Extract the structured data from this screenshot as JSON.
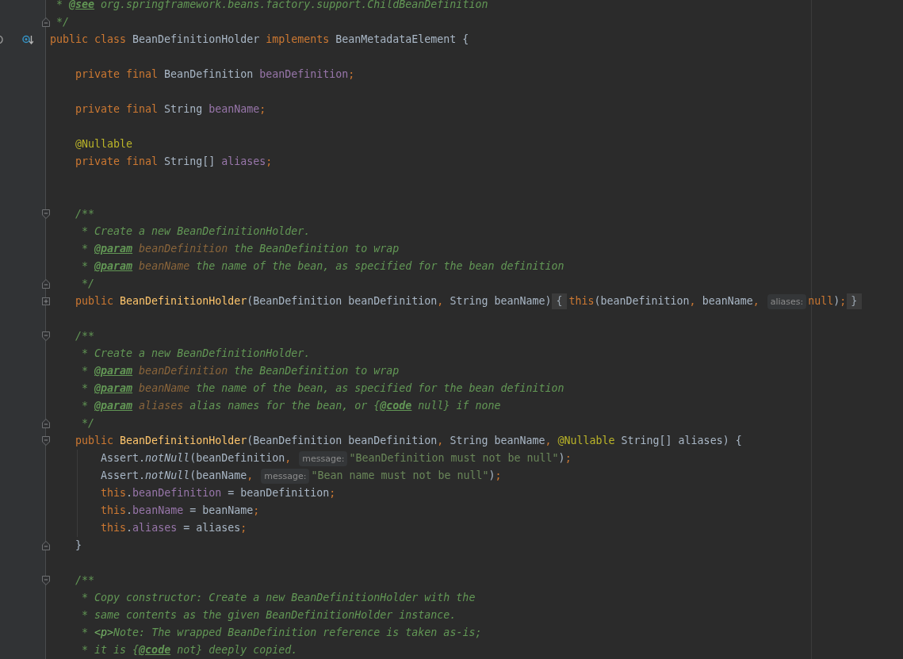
{
  "editor": {
    "lines": [
      {
        "kind": "code",
        "parts": [
          {
            "kind": "code",
            "tokens": [
              {
                "text": " * ",
                "kind": "doc"
              },
              {
                "text": "@see",
                "kind": "doc-tag"
              },
              {
                "text": " org.springframework.beans.factory.support.ChildBeanDefinition",
                "kind": "doc"
              }
            ]
          }
        ]
      },
      {
        "kind": "code",
        "fold": {
          "kind": "end"
        },
        "parts": [
          {
            "kind": "code",
            "tokens": [
              {
                "text": " */",
                "kind": "doc"
              }
            ]
          }
        ]
      },
      {
        "kind": "code",
        "gutter_icons": [
          {
            "kind": "arc"
          },
          {
            "kind": "implemented"
          }
        ],
        "parts": [
          {
            "kind": "code",
            "tokens": [
              {
                "text": "public class ",
                "kind": "keyword"
              },
              {
                "text": "BeanDefinitionHolder ",
                "kind": "plain"
              },
              {
                "text": "implements ",
                "kind": "keyword"
              },
              {
                "text": "BeanMetadataElement {",
                "kind": "plain"
              }
            ]
          }
        ]
      },
      {
        "kind": "blank"
      },
      {
        "kind": "code",
        "parts": [
          {
            "kind": "code",
            "tokens": [
              {
                "text": "    private final ",
                "kind": "keyword"
              },
              {
                "text": "BeanDefinition ",
                "kind": "plain"
              },
              {
                "text": "beanDefinition",
                "kind": "field"
              },
              {
                "text": ";",
                "kind": "keyword"
              }
            ]
          }
        ]
      },
      {
        "kind": "blank"
      },
      {
        "kind": "code",
        "parts": [
          {
            "kind": "code",
            "tokens": [
              {
                "text": "    private final ",
                "kind": "keyword"
              },
              {
                "text": "String ",
                "kind": "plain"
              },
              {
                "text": "beanName",
                "kind": "field"
              },
              {
                "text": ";",
                "kind": "keyword"
              }
            ]
          }
        ]
      },
      {
        "kind": "blank"
      },
      {
        "kind": "code",
        "parts": [
          {
            "kind": "code",
            "tokens": [
              {
                "text": "    @Nullable",
                "kind": "annotation"
              }
            ]
          }
        ]
      },
      {
        "kind": "code",
        "parts": [
          {
            "kind": "code",
            "tokens": [
              {
                "text": "    private final ",
                "kind": "keyword"
              },
              {
                "text": "String[] ",
                "kind": "plain"
              },
              {
                "text": "aliases",
                "kind": "field"
              },
              {
                "text": ";",
                "kind": "keyword"
              }
            ]
          }
        ]
      },
      {
        "kind": "blank"
      },
      {
        "kind": "blank"
      },
      {
        "kind": "code",
        "fold": {
          "kind": "start"
        },
        "parts": [
          {
            "kind": "code",
            "tokens": [
              {
                "text": "    /**",
                "kind": "doc"
              }
            ]
          }
        ]
      },
      {
        "kind": "code",
        "parts": [
          {
            "kind": "code",
            "tokens": [
              {
                "text": "     * Create a new BeanDefinitionHolder.",
                "kind": "doc"
              }
            ]
          }
        ]
      },
      {
        "kind": "code",
        "parts": [
          {
            "kind": "code",
            "tokens": [
              {
                "text": "     * ",
                "kind": "doc"
              },
              {
                "text": "@param",
                "kind": "doc-tag"
              },
              {
                "text": " beanDefinition",
                "kind": "doc-param"
              },
              {
                "text": " the BeanDefinition to wrap",
                "kind": "doc"
              }
            ]
          }
        ]
      },
      {
        "kind": "code",
        "parts": [
          {
            "kind": "code",
            "tokens": [
              {
                "text": "     * ",
                "kind": "doc"
              },
              {
                "text": "@param",
                "kind": "doc-tag"
              },
              {
                "text": " beanName",
                "kind": "doc-param"
              },
              {
                "text": " the name of the bean, as specified for the bean definition",
                "kind": "doc"
              }
            ]
          }
        ]
      },
      {
        "kind": "code",
        "fold": {
          "kind": "end"
        },
        "parts": [
          {
            "kind": "code",
            "tokens": [
              {
                "text": "     */",
                "kind": "doc"
              }
            ]
          }
        ]
      },
      {
        "kind": "code",
        "fold": {
          "kind": "collapsed"
        },
        "parts": [
          {
            "kind": "code",
            "tokens": [
              {
                "text": "    public ",
                "kind": "keyword"
              },
              {
                "text": "BeanDefinitionHolder",
                "kind": "method"
              },
              {
                "text": "(BeanDefinition beanDefinition",
                "kind": "plain"
              },
              {
                "text": ", ",
                "kind": "keyword"
              },
              {
                "text": "String beanName)",
                "kind": "plain"
              }
            ]
          },
          {
            "kind": "fold",
            "text": "{"
          },
          {
            "kind": "code",
            "tokens": [
              {
                "text": "this",
                "kind": "keyword"
              },
              {
                "text": "(beanDefinition",
                "kind": "plain"
              },
              {
                "text": ", ",
                "kind": "keyword"
              },
              {
                "text": "beanName",
                "kind": "plain"
              },
              {
                "text": ",",
                "kind": "keyword"
              }
            ]
          },
          {
            "kind": "hint",
            "text": "aliases:"
          },
          {
            "kind": "code",
            "tokens": [
              {
                "text": "null",
                "kind": "keyword"
              },
              {
                "text": ")",
                "kind": "plain"
              },
              {
                "text": ";",
                "kind": "keyword"
              }
            ]
          },
          {
            "kind": "fold",
            "text": "}"
          }
        ]
      },
      {
        "kind": "blank"
      },
      {
        "kind": "code",
        "fold": {
          "kind": "start"
        },
        "parts": [
          {
            "kind": "code",
            "tokens": [
              {
                "text": "    /**",
                "kind": "doc"
              }
            ]
          }
        ]
      },
      {
        "kind": "code",
        "parts": [
          {
            "kind": "code",
            "tokens": [
              {
                "text": "     * Create a new BeanDefinitionHolder.",
                "kind": "doc"
              }
            ]
          }
        ]
      },
      {
        "kind": "code",
        "parts": [
          {
            "kind": "code",
            "tokens": [
              {
                "text": "     * ",
                "kind": "doc"
              },
              {
                "text": "@param",
                "kind": "doc-tag"
              },
              {
                "text": " beanDefinition",
                "kind": "doc-param"
              },
              {
                "text": " the BeanDefinition to wrap",
                "kind": "doc"
              }
            ]
          }
        ]
      },
      {
        "kind": "code",
        "parts": [
          {
            "kind": "code",
            "tokens": [
              {
                "text": "     * ",
                "kind": "doc"
              },
              {
                "text": "@param",
                "kind": "doc-tag"
              },
              {
                "text": " beanName",
                "kind": "doc-param"
              },
              {
                "text": " the name of the bean, as specified for the bean definition",
                "kind": "doc"
              }
            ]
          }
        ]
      },
      {
        "kind": "code",
        "parts": [
          {
            "kind": "code",
            "tokens": [
              {
                "text": "     * ",
                "kind": "doc"
              },
              {
                "text": "@param",
                "kind": "doc-tag"
              },
              {
                "text": " aliases",
                "kind": "doc-param"
              },
              {
                "text": " alias names for the bean, or {",
                "kind": "doc"
              },
              {
                "text": "@code",
                "kind": "doc-tag"
              },
              {
                "text": " null} if none",
                "kind": "doc"
              }
            ]
          }
        ]
      },
      {
        "kind": "code",
        "fold": {
          "kind": "end"
        },
        "parts": [
          {
            "kind": "code",
            "tokens": [
              {
                "text": "     */",
                "kind": "doc"
              }
            ]
          }
        ]
      },
      {
        "kind": "code",
        "fold": {
          "kind": "start"
        },
        "parts": [
          {
            "kind": "code",
            "tokens": [
              {
                "text": "    public ",
                "kind": "keyword"
              },
              {
                "text": "BeanDefinitionHolder",
                "kind": "method"
              },
              {
                "text": "(BeanDefinition beanDefinition",
                "kind": "plain"
              },
              {
                "text": ", ",
                "kind": "keyword"
              },
              {
                "text": "String beanName",
                "kind": "plain"
              },
              {
                "text": ", ",
                "kind": "keyword"
              },
              {
                "text": "@Nullable",
                "kind": "annotation"
              },
              {
                "text": " String[] aliases) {",
                "kind": "plain"
              }
            ]
          }
        ]
      },
      {
        "kind": "code",
        "parts": [
          {
            "kind": "code",
            "tokens": [
              {
                "text": "        Assert.",
                "kind": "plain"
              },
              {
                "text": "notNull",
                "kind": "static-call"
              },
              {
                "text": "(beanDefinition",
                "kind": "plain"
              },
              {
                "text": ",",
                "kind": "keyword"
              }
            ]
          },
          {
            "kind": "hint",
            "text": "message:"
          },
          {
            "kind": "code",
            "tokens": [
              {
                "text": "\"BeanDefinition must not be null\"",
                "kind": "string"
              },
              {
                "text": ")",
                "kind": "plain"
              },
              {
                "text": ";",
                "kind": "keyword"
              }
            ]
          }
        ]
      },
      {
        "kind": "code",
        "parts": [
          {
            "kind": "code",
            "tokens": [
              {
                "text": "        Assert.",
                "kind": "plain"
              },
              {
                "text": "notNull",
                "kind": "static-call"
              },
              {
                "text": "(beanName",
                "kind": "plain"
              },
              {
                "text": ",",
                "kind": "keyword"
              }
            ]
          },
          {
            "kind": "hint",
            "text": "message:"
          },
          {
            "kind": "code",
            "tokens": [
              {
                "text": "\"Bean name must not be null\"",
                "kind": "string"
              },
              {
                "text": ")",
                "kind": "plain"
              },
              {
                "text": ";",
                "kind": "keyword"
              }
            ]
          }
        ]
      },
      {
        "kind": "code",
        "parts": [
          {
            "kind": "code",
            "tokens": [
              {
                "text": "        this",
                "kind": "keyword"
              },
              {
                "text": ".",
                "kind": "plain"
              },
              {
                "text": "beanDefinition",
                "kind": "field"
              },
              {
                "text": " = beanDefinition",
                "kind": "plain"
              },
              {
                "text": ";",
                "kind": "keyword"
              }
            ]
          }
        ]
      },
      {
        "kind": "code",
        "parts": [
          {
            "kind": "code",
            "tokens": [
              {
                "text": "        this",
                "kind": "keyword"
              },
              {
                "text": ".",
                "kind": "plain"
              },
              {
                "text": "beanName",
                "kind": "field"
              },
              {
                "text": " = beanName",
                "kind": "plain"
              },
              {
                "text": ";",
                "kind": "keyword"
              }
            ]
          }
        ]
      },
      {
        "kind": "code",
        "parts": [
          {
            "kind": "code",
            "tokens": [
              {
                "text": "        this",
                "kind": "keyword"
              },
              {
                "text": ".",
                "kind": "plain"
              },
              {
                "text": "aliases",
                "kind": "field"
              },
              {
                "text": " = aliases",
                "kind": "plain"
              },
              {
                "text": ";",
                "kind": "keyword"
              }
            ]
          }
        ]
      },
      {
        "kind": "code",
        "fold": {
          "kind": "end"
        },
        "parts": [
          {
            "kind": "code",
            "tokens": [
              {
                "text": "    }",
                "kind": "plain"
              }
            ]
          }
        ]
      },
      {
        "kind": "blank"
      },
      {
        "kind": "code",
        "fold": {
          "kind": "start"
        },
        "parts": [
          {
            "kind": "code",
            "tokens": [
              {
                "text": "    /**",
                "kind": "doc"
              }
            ]
          }
        ]
      },
      {
        "kind": "code",
        "parts": [
          {
            "kind": "code",
            "tokens": [
              {
                "text": "     * Copy constructor: Create a new BeanDefinitionHolder with the",
                "kind": "doc"
              }
            ]
          }
        ]
      },
      {
        "kind": "code",
        "parts": [
          {
            "kind": "code",
            "tokens": [
              {
                "text": "     * same contents as the given BeanDefinitionHolder instance.",
                "kind": "doc"
              }
            ]
          }
        ]
      },
      {
        "kind": "code",
        "parts": [
          {
            "kind": "code",
            "tokens": [
              {
                "text": "     * ",
                "kind": "doc"
              },
              {
                "text": "<p>",
                "kind": "doc-markup"
              },
              {
                "text": "Note: The wrapped BeanDefinition reference is taken as-is;",
                "kind": "doc"
              }
            ]
          }
        ]
      },
      {
        "kind": "code",
        "parts": [
          {
            "kind": "code",
            "tokens": [
              {
                "text": "     * it is {",
                "kind": "doc"
              },
              {
                "text": "@code",
                "kind": "doc-tag"
              },
              {
                "text": " not} deeply copied.",
                "kind": "doc"
              }
            ]
          }
        ]
      }
    ]
  }
}
